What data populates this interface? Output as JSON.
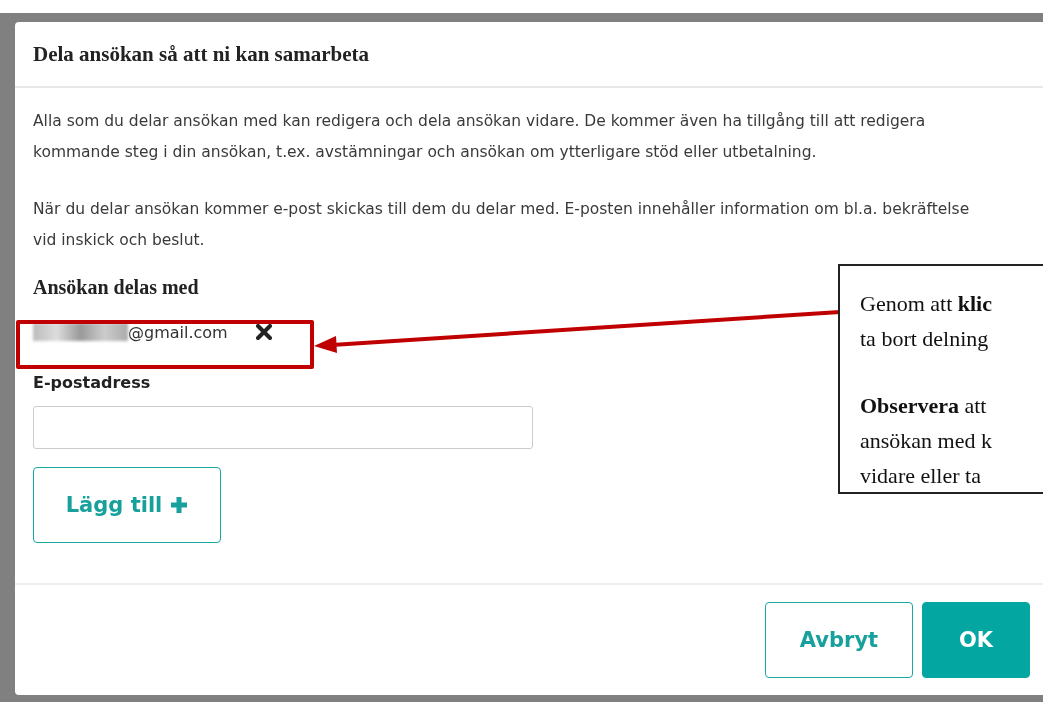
{
  "dialog": {
    "title": "Dela ansökan så att ni kan samarbeta",
    "paragraphs": [
      "Alla som du delar ansökan med kan redigera och dela ansökan vidare. De kommer även ha tillgång till att redigera kommande steg i din ansökan, t.ex. avstämningar och ansökan om ytterligare stöd eller utbetalning.",
      "När du delar ansökan kommer e-post skickas till dem du delar med. E-posten innehåller information om bl.a. bekräftelse vid inskick och beslut."
    ],
    "shared_heading": "Ansökan delas med",
    "shared_with": [
      {
        "email": "@gmail.com"
      }
    ],
    "email_field": {
      "label": "E-postadress"
    },
    "add_button": "Lägg till",
    "buttons": [
      {
        "label": "Avbryt",
        "kind": "secondary"
      },
      {
        "label": "OK",
        "kind": "primary"
      }
    ]
  },
  "callout": {
    "paragraphs": [
      [
        "Genom att **klic**",
        "ta bort delning"
      ],
      [
        "**Observera** att",
        "ansökan med k",
        "vidare eller ta"
      ]
    ]
  }
}
